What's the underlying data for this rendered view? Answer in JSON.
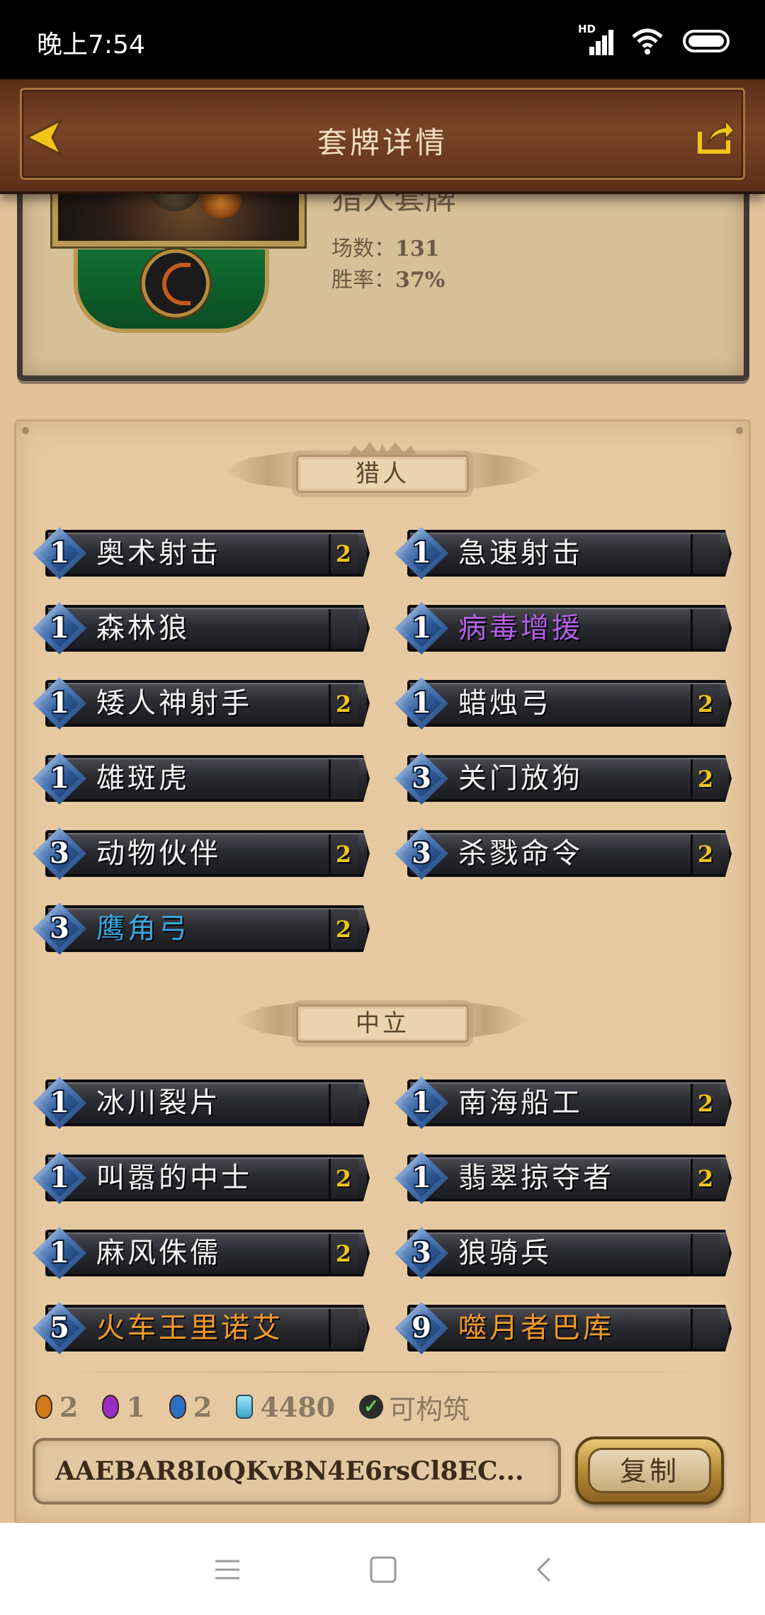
{
  "status_bar": {
    "time": "晚上7:54",
    "signal_label": "HD",
    "icons": [
      "signal-icon",
      "wifi-icon",
      "battery-icon"
    ]
  },
  "header": {
    "title": "套牌详情",
    "back_icon": "back-arrow-icon",
    "share_icon": "share-icon"
  },
  "deck": {
    "name": "猎人套牌",
    "games_label": "场数：",
    "games_value": "131",
    "winrate_label": "胜率：",
    "winrate_value": "37%"
  },
  "sections": [
    {
      "label": "猎人",
      "cards": [
        {
          "cost": "1",
          "name": "奥术射击",
          "count": "2",
          "color": "#f2f2f2"
        },
        {
          "cost": "1",
          "name": "急速射击",
          "count": "",
          "color": "#f2f2f2"
        },
        {
          "cost": "1",
          "name": "森林狼",
          "count": "",
          "color": "#f2f2f2"
        },
        {
          "cost": "1",
          "name": "病毒增援",
          "count": "",
          "color": "#b560e8"
        },
        {
          "cost": "1",
          "name": "矮人神射手",
          "count": "2",
          "color": "#f2f2f2"
        },
        {
          "cost": "1",
          "name": "蜡烛弓",
          "count": "2",
          "color": "#f2f2f2"
        },
        {
          "cost": "1",
          "name": "雄斑虎",
          "count": "",
          "color": "#f2f2f2"
        },
        {
          "cost": "3",
          "name": "关门放狗",
          "count": "2",
          "color": "#f2f2f2"
        },
        {
          "cost": "3",
          "name": "动物伙伴",
          "count": "2",
          "color": "#f2f2f2"
        },
        {
          "cost": "3",
          "name": "杀戮命令",
          "count": "2",
          "color": "#f2f2f2"
        },
        {
          "cost": "3",
          "name": "鹰角弓",
          "count": "2",
          "color": "#3aa6e0"
        }
      ]
    },
    {
      "label": "中立",
      "cards": [
        {
          "cost": "1",
          "name": "冰川裂片",
          "count": "",
          "color": "#f2f2f2"
        },
        {
          "cost": "1",
          "name": "南海船工",
          "count": "2",
          "color": "#f2f2f2"
        },
        {
          "cost": "1",
          "name": "叫嚣的中士",
          "count": "2",
          "color": "#f2f2f2"
        },
        {
          "cost": "1",
          "name": "翡翠掠夺者",
          "count": "2",
          "color": "#f2f2f2"
        },
        {
          "cost": "1",
          "name": "麻风侏儒",
          "count": "2",
          "color": "#f2f2f2"
        },
        {
          "cost": "3",
          "name": "狼骑兵",
          "count": "",
          "color": "#f2f2f2"
        },
        {
          "cost": "5",
          "name": "火车王里诺艾",
          "count": "",
          "color": "#f39a2c"
        },
        {
          "cost": "9",
          "name": "噬月者巴库",
          "count": "",
          "color": "#f39a2c"
        }
      ]
    }
  ],
  "stats": {
    "legendary_count": "2",
    "epic_count": "1",
    "rare_count": "2",
    "dust_cost": "4480",
    "craftable_status": "可构筑",
    "colors": {
      "legendary": "#d07a1a",
      "epic": "#9a2ec4",
      "rare": "#2f6fc2",
      "dust": "#6ac8e6"
    }
  },
  "deck_code": "AAEBAR8IoQKvBN4E6rsCl8EC...",
  "copy_label": "复制",
  "nav": {
    "icons": [
      "menu-icon",
      "home-icon",
      "back-icon"
    ]
  }
}
